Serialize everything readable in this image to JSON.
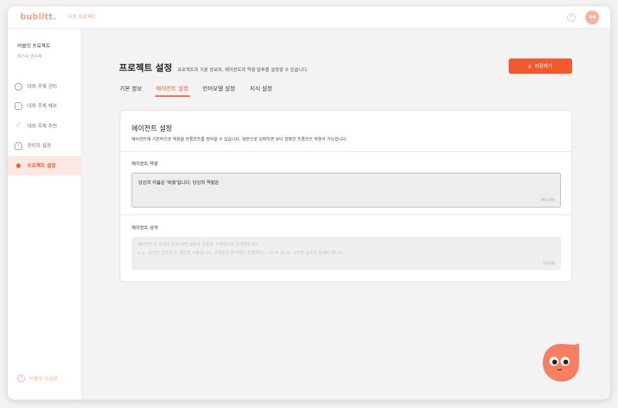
{
  "header": {
    "logo": "bublitt.",
    "breadcrumb": "나의 프로젝트"
  },
  "sidebar": {
    "project_name": "버블잇 프로젝트",
    "project_role": "마스터 관리자",
    "items": [
      {
        "label": "대화 주제 관리",
        "icon": "minus-circle-icon"
      },
      {
        "label": "대화 주제 배포",
        "icon": "terminal-icon"
      },
      {
        "label": "대화 주제 추천",
        "icon": "magic-wand-icon"
      },
      {
        "label": "관리자 설정",
        "icon": "user-icon"
      },
      {
        "label": "프로젝트 설정",
        "icon": "gear-icon"
      }
    ],
    "guide": "버블잇 도움말"
  },
  "page": {
    "title": "프로젝트 설정",
    "subtitle": "프로젝트의 기본 정보와, 에이전트의 역할·말투를 설정할 수 있습니다.",
    "save_label": "저장하기",
    "tabs": [
      "기본 정보",
      "에이전트 설정",
      "언어모델 설정",
      "지식 설정"
    ],
    "active_tab": "에이전트 설정"
  },
  "card": {
    "title": "에이전트 설정",
    "description": "에이전트에 기본적으로 적용할 프롬프트를 정의할 수 있습니다. 영문으로 입력하면 보다 정확한 프롬프트 적용이 가능합니다.",
    "role": {
      "label": "에이전트 역할",
      "value": "당신의 이름은 '버블'입니다. 당신의 역할은",
      "counter": "26/100"
    },
    "personality": {
      "label": "에이전트 성격",
      "placeholder_line1": "에이전트의 성격과 함께 어떤 말투로 답할지 구체적으로 입력해주세요.",
      "placeholder_line2": "e.g., 당신은 친절하고, 명랑한 사람입니다. 고객들의 문의에는 친절하되, '~요'로 끝나는 공손한 말투로 답해야 합니다.",
      "counter": "0/100"
    }
  },
  "colors": {
    "accent": "#f2592f",
    "accent_light": "#fde9e3",
    "mascot": "#f47f62"
  }
}
